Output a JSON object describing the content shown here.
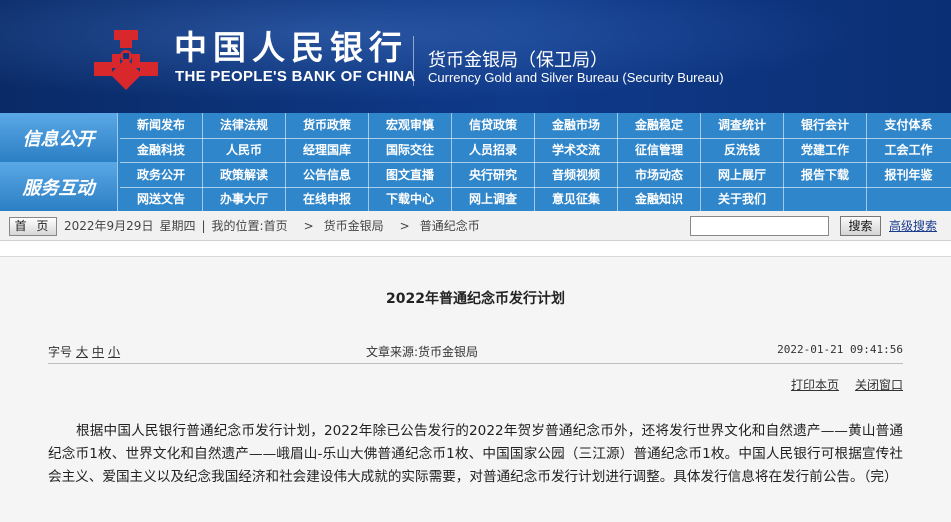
{
  "header": {
    "bank_cn": "中国人民银行",
    "bank_en": "THE PEOPLE'S BANK OF CHINA",
    "bureau_cn": "货币金银局（保卫局）",
    "bureau_en": "Currency  Gold and Silver Bureau (Security Bureau)",
    "emblem_icon": "pboc-emblem-icon",
    "emblem_color": "#d8282c"
  },
  "nav": {
    "section_a_label": "信息公开",
    "section_b_label": "服务互动",
    "rows": [
      [
        "新闻发布",
        "法律法规",
        "货币政策",
        "宏观审慎",
        "信贷政策",
        "金融市场",
        "金融稳定",
        "调查统计",
        "银行会计",
        "支付体系"
      ],
      [
        "金融科技",
        "人民币",
        "经理国库",
        "国际交往",
        "人员招录",
        "学术交流",
        "征信管理",
        "反洗钱",
        "党建工作",
        "工会工作"
      ],
      [
        "政务公开",
        "政策解读",
        "公告信息",
        "图文直播",
        "央行研究",
        "音频视频",
        "市场动态",
        "网上展厅",
        "报告下载",
        "报刊年鉴"
      ],
      [
        "网送文告",
        "办事大厅",
        "在线申报",
        "下载中心",
        "网上调查",
        "意见征集",
        "金融知识",
        "关于我们",
        "",
        ""
      ]
    ]
  },
  "crumbbar": {
    "home_label": "首 页",
    "date": "2022年9月29日",
    "weekday": "星期四",
    "location_label": "我的位置:",
    "crumbs": [
      "首页",
      "货币金银局",
      "普通纪念币"
    ],
    "separator": ">",
    "pipe": "|",
    "search_button": "搜索",
    "advanced_search": "高级搜索"
  },
  "article": {
    "title": "2022年普通纪念币发行计划",
    "fontsize_label": "字号",
    "fontsize_options": [
      "大",
      "中",
      "小"
    ],
    "source": "文章来源:货币金银局",
    "datetime": "2022-01-21 09:41:56",
    "print_label": "打印本页",
    "close_label": "关闭窗口",
    "body": "根据中国人民银行普通纪念币发行计划，2022年除已公告发行的2022年贺岁普通纪念币外，还将发行世界文化和自然遗产——黄山普通纪念币1枚、世界文化和自然遗产——峨眉山-乐山大佛普通纪念币1枚、中国国家公园（三江源）普通纪念币1枚。中国人民银行可根据宣传社会主义、爱国主义以及纪念我国经济和社会建设伟大成就的实际需要，对普通纪念币发行计划进行调整。具体发行信息将在发行前公告。（完）"
  }
}
